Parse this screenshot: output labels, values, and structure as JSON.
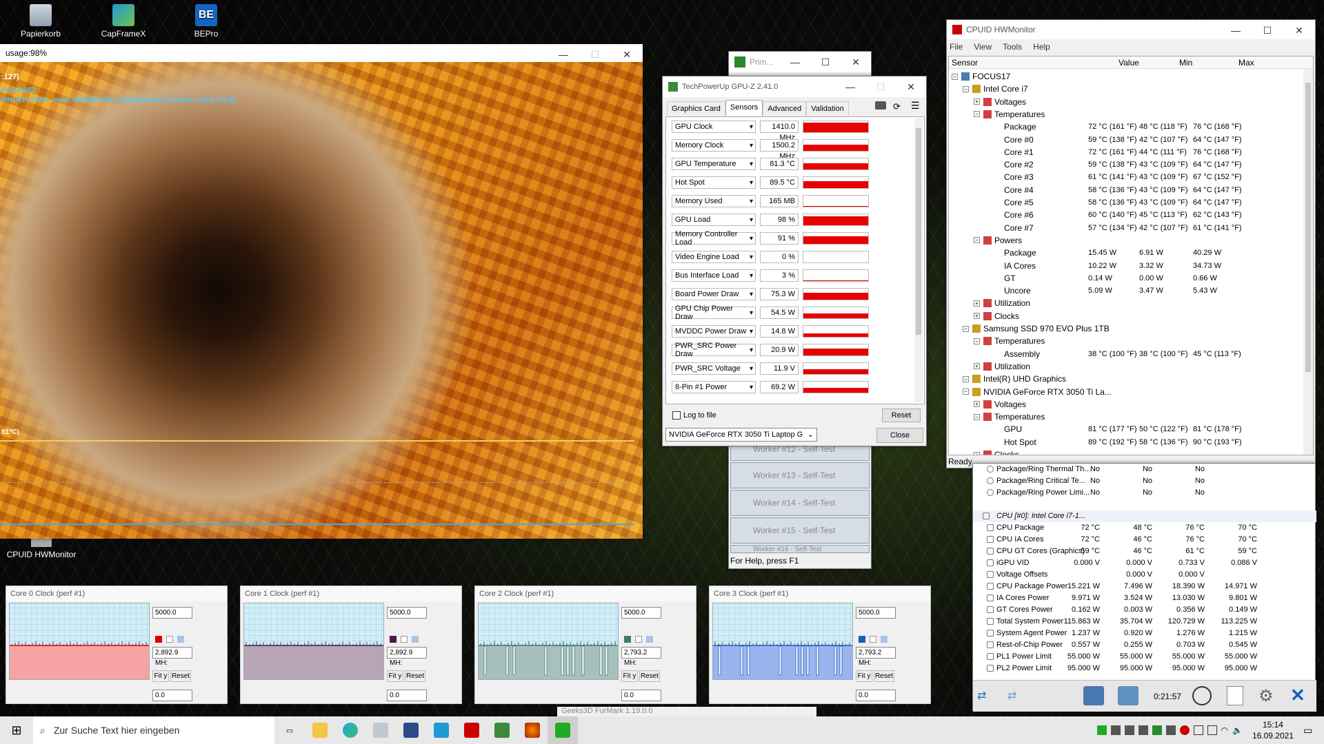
{
  "desktop": {
    "icons": [
      {
        "label": "Papierkorb"
      },
      {
        "label": "CapFrameX"
      },
      {
        "label": "BEPro"
      }
    ],
    "hwmon_shortcut": "CPUID HWMonitor"
  },
  "furmark": {
    "title": "usage:98%",
    "hud_line1": ":127)",
    "hud_line2": "PCIe/SSE2",
    "hud_line3": "MHz/81°C/98%, mem: 6000MHz/4%, limits[power:1, temp:0, volt:0, OV:0]",
    "graph_label": "81°C)"
  },
  "prime": {
    "title": "Prim...",
    "workers": [
      "Worker #12 - Self-Test",
      "Worker #13 - Self-Test",
      "Worker #14 - Self-Test",
      "Worker #15 - Self-Test",
      "Worker #16 - Self-Test"
    ],
    "status": "For Help, press F1"
  },
  "gpuz": {
    "title": "TechPowerUp GPU-Z 2.41.0",
    "tabs": [
      "Graphics Card",
      "Sensors",
      "Advanced",
      "Validation"
    ],
    "active_tab": "Sensors",
    "sensors": [
      {
        "name": "GPU Clock",
        "value": "1410.0 MHz",
        "level": 0.9
      },
      {
        "name": "Memory Clock",
        "value": "1500.2 MHz",
        "level": 0.55
      },
      {
        "name": "GPU Temperature",
        "value": "81.3 °C",
        "level": 0.55
      },
      {
        "name": "Hot Spot",
        "value": "89.5 °C",
        "level": 0.62
      },
      {
        "name": "Memory Used",
        "value": "165 MB",
        "level": 0.05
      },
      {
        "name": "GPU Load",
        "value": "98 %",
        "level": 0.8
      },
      {
        "name": "Memory Controller Load",
        "value": "91 %",
        "level": 0.7
      },
      {
        "name": "Video Engine Load",
        "value": "0 %",
        "level": 0
      },
      {
        "name": "Bus Interface Load",
        "value": "3 %",
        "level": 0.05
      },
      {
        "name": "Board Power Draw",
        "value": "75.3 W",
        "level": 0.6
      },
      {
        "name": "GPU Chip Power Draw",
        "value": "54.5 W",
        "level": 0.45
      },
      {
        "name": "MVDDC Power Draw",
        "value": "14.8 W",
        "level": 0.3
      },
      {
        "name": "PWR_SRC Power Draw",
        "value": "20.9 W",
        "level": 0.6
      },
      {
        "name": "PWR_SRC Voltage",
        "value": "11.9 V",
        "level": 0.45
      },
      {
        "name": "8-Pin #1 Power",
        "value": "69.2 W",
        "level": 0.45
      }
    ],
    "log_label": "Log to file",
    "reset": "Reset",
    "device": "NVIDIA GeForce RTX 3050 Ti Laptop G",
    "close": "Close"
  },
  "hwmon": {
    "title": "CPUID HWMonitor",
    "menu": [
      "File",
      "View",
      "Tools",
      "Help"
    ],
    "columns": [
      "Sensor",
      "Value",
      "Min",
      "Max"
    ],
    "status": "Ready",
    "rows": [
      {
        "d": 0,
        "t": "FOCUS17",
        "v": "",
        "mi": "",
        "ma": ""
      },
      {
        "d": 1,
        "t": "Intel Core i7",
        "v": "",
        "mi": "",
        "ma": ""
      },
      {
        "d": 2,
        "t": "Voltages",
        "v": "",
        "mi": "",
        "ma": ""
      },
      {
        "d": 2,
        "t": "Temperatures",
        "v": "",
        "mi": "",
        "ma": ""
      },
      {
        "d": 3,
        "t": "Package",
        "v": "72 °C  (161 °F)",
        "mi": "48 °C  (118 °F)",
        "ma": "76 °C  (168 °F)"
      },
      {
        "d": 3,
        "t": "Core #0",
        "v": "59 °C  (138 °F)",
        "mi": "42 °C  (107 °F)",
        "ma": "64 °C  (147 °F)"
      },
      {
        "d": 3,
        "t": "Core #1",
        "v": "72 °C  (161 °F)",
        "mi": "44 °C  (111 °F)",
        "ma": "76 °C  (168 °F)"
      },
      {
        "d": 3,
        "t": "Core #2",
        "v": "59 °C  (138 °F)",
        "mi": "43 °C  (109 °F)",
        "ma": "64 °C  (147 °F)"
      },
      {
        "d": 3,
        "t": "Core #3",
        "v": "61 °C  (141 °F)",
        "mi": "43 °C  (109 °F)",
        "ma": "67 °C  (152 °F)"
      },
      {
        "d": 3,
        "t": "Core #4",
        "v": "58 °C  (136 °F)",
        "mi": "43 °C  (109 °F)",
        "ma": "64 °C  (147 °F)"
      },
      {
        "d": 3,
        "t": "Core #5",
        "v": "58 °C  (136 °F)",
        "mi": "43 °C  (109 °F)",
        "ma": "64 °C  (147 °F)"
      },
      {
        "d": 3,
        "t": "Core #6",
        "v": "60 °C  (140 °F)",
        "mi": "45 °C  (113 °F)",
        "ma": "62 °C  (143 °F)"
      },
      {
        "d": 3,
        "t": "Core #7",
        "v": "57 °C  (134 °F)",
        "mi": "42 °C  (107 °F)",
        "ma": "61 °C  (141 °F)"
      },
      {
        "d": 2,
        "t": "Powers",
        "v": "",
        "mi": "",
        "ma": ""
      },
      {
        "d": 3,
        "t": "Package",
        "v": "15.45 W",
        "mi": "6.91 W",
        "ma": "40.29 W"
      },
      {
        "d": 3,
        "t": "IA Cores",
        "v": "10.22 W",
        "mi": "3.32 W",
        "ma": "34.73 W"
      },
      {
        "d": 3,
        "t": "GT",
        "v": "0.14 W",
        "mi": "0.00 W",
        "ma": "0.66 W"
      },
      {
        "d": 3,
        "t": "Uncore",
        "v": "5.09 W",
        "mi": "3.47 W",
        "ma": "5.43 W"
      },
      {
        "d": 2,
        "t": "Utilization",
        "v": "",
        "mi": "",
        "ma": ""
      },
      {
        "d": 2,
        "t": "Clocks",
        "v": "",
        "mi": "",
        "ma": ""
      },
      {
        "d": 1,
        "t": "Samsung SSD 970 EVO Plus 1TB",
        "v": "",
        "mi": "",
        "ma": ""
      },
      {
        "d": 2,
        "t": "Temperatures",
        "v": "",
        "mi": "",
        "ma": ""
      },
      {
        "d": 3,
        "t": "Assembly",
        "v": "38 °C  (100 °F)",
        "mi": "38 °C  (100 °F)",
        "ma": "45 °C  (113 °F)"
      },
      {
        "d": 2,
        "t": "Utilization",
        "v": "",
        "mi": "",
        "ma": ""
      },
      {
        "d": 1,
        "t": "Intel(R) UHD Graphics",
        "v": "",
        "mi": "",
        "ma": ""
      },
      {
        "d": 1,
        "t": "NVIDIA GeForce RTX 3050 Ti La...",
        "v": "",
        "mi": "",
        "ma": ""
      },
      {
        "d": 2,
        "t": "Voltages",
        "v": "",
        "mi": "",
        "ma": ""
      },
      {
        "d": 2,
        "t": "Temperatures",
        "v": "",
        "mi": "",
        "ma": ""
      },
      {
        "d": 3,
        "t": "GPU",
        "v": "81 °C  (177 °F)",
        "mi": "50 °C  (122 °F)",
        "ma": "81 °C  (178 °F)"
      },
      {
        "d": 3,
        "t": "Hot Spot",
        "v": "89 °C  (192 °F)",
        "mi": "58 °C  (136 °F)",
        "ma": "90 °C  (193 °F)"
      },
      {
        "d": 2,
        "t": "Clocks",
        "v": "",
        "mi": "",
        "ma": ""
      }
    ]
  },
  "hwinfo": {
    "elapsed": "0:21:57",
    "rows": [
      {
        "t": "Package/Ring Thermal Th...",
        "a": "No",
        "b": "No",
        "c": "No",
        "d": ""
      },
      {
        "t": "Package/Ring Critical Te...",
        "a": "No",
        "b": "No",
        "c": "No",
        "d": ""
      },
      {
        "t": "Package/Ring Power Limi...",
        "a": "No",
        "b": "No",
        "c": "No",
        "d": ""
      },
      {
        "t": "",
        "a": "",
        "b": "",
        "c": "",
        "d": ""
      },
      {
        "t": "CPU [#0]: Intel Core i7-1...",
        "a": "",
        "b": "",
        "c": "",
        "d": ""
      },
      {
        "t": "CPU Package",
        "a": "72 °C",
        "b": "48 °C",
        "c": "76 °C",
        "d": "70 °C"
      },
      {
        "t": "CPU IA Cores",
        "a": "72 °C",
        "b": "46 °C",
        "c": "76 °C",
        "d": "70 °C"
      },
      {
        "t": "CPU GT Cores (Graphics)",
        "a": "59 °C",
        "b": "46 °C",
        "c": "61 °C",
        "d": "59 °C"
      },
      {
        "t": "iGPU VID",
        "a": "0.000 V",
        "b": "0.000 V",
        "c": "0.733 V",
        "d": "0.086 V"
      },
      {
        "t": "Voltage Offsets",
        "a": "",
        "b": "0.000 V",
        "c": "0.000 V",
        "d": ""
      },
      {
        "t": "CPU Package Power",
        "a": "15.221 W",
        "b": "7.496 W",
        "c": "18.390 W",
        "d": "14.971 W"
      },
      {
        "t": "IA Cores Power",
        "a": "9.971 W",
        "b": "3.524 W",
        "c": "13.030 W",
        "d": "9.801 W"
      },
      {
        "t": "GT Cores Power",
        "a": "0.162 W",
        "b": "0.003 W",
        "c": "0.356 W",
        "d": "0.149 W"
      },
      {
        "t": "Total System Power",
        "a": "115.863 W",
        "b": "35.704 W",
        "c": "120.729 W",
        "d": "113.225 W"
      },
      {
        "t": "System Agent Power",
        "a": "1.237 W",
        "b": "0.920 W",
        "c": "1.276 W",
        "d": "1.215 W"
      },
      {
        "t": "Rest-of-Chip Power",
        "a": "0.557 W",
        "b": "0.255 W",
        "c": "0.703 W",
        "d": "0.545 W"
      },
      {
        "t": "PL1 Power Limit",
        "a": "55.000 W",
        "b": "55.000 W",
        "c": "55.000 W",
        "d": "55.000 W"
      },
      {
        "t": "PL2 Power Limit",
        "a": "95.000 W",
        "b": "95.000 W",
        "c": "95.000 W",
        "d": "95.000 W"
      }
    ]
  },
  "perf": [
    {
      "title": "Core 0 Clock (perf #1)",
      "max": "5000.0",
      "cur": "2,892.9 MH:",
      "min": "0.0",
      "color": "#f6a3a3",
      "swatch": "#e00000"
    },
    {
      "title": "Core 1 Clock (perf #1)",
      "max": "5000.0",
      "cur": "2,892.9 MH:",
      "min": "0.0",
      "color": "#b7a4b7",
      "swatch": "#4a1a4a"
    },
    {
      "title": "Core 2 Clock (perf #1)",
      "max": "5000.0",
      "cur": "2,793.2 MH:",
      "min": "0.0",
      "color": "#a8c0bc",
      "swatch": "#3d7c6f"
    },
    {
      "title": "Core 3 Clock (perf #1)",
      "max": "5000.0",
      "cur": "2,793.2 MH:",
      "min": "0.0",
      "color": "#9ab4f0",
      "swatch": "#1060c0"
    }
  ],
  "perf_buttons": {
    "fit": "Fit y",
    "reset": "Reset"
  },
  "furmark_task": "Geeks3D FurMark 1.19.0.0",
  "taskbar": {
    "search": "Zur Suche Text hier eingeben",
    "time": "15:14",
    "date": "16.09.2021"
  }
}
